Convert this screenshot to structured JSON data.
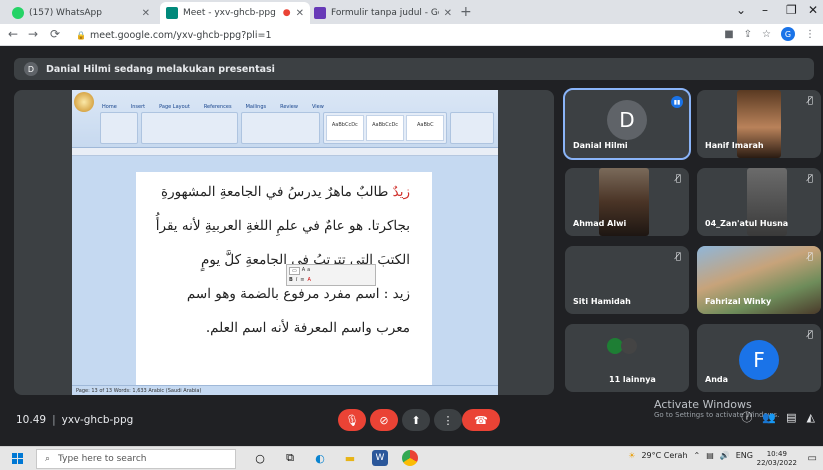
{
  "browser": {
    "tabs": [
      {
        "title": "(157) WhatsApp",
        "color": "#25d366"
      },
      {
        "title": "Meet - yxv-ghcb-ppg",
        "color": "#00897b"
      },
      {
        "title": "Formulir tanpa judul - Google Fo",
        "color": "#673ab7"
      }
    ],
    "url": "meet.google.com/yxv-ghcb-ppg?pli=1",
    "profile_initial": "G"
  },
  "presenter_bar": {
    "initial": "D",
    "text": "Danial Hilmi sedang melakukan presentasi"
  },
  "word_document": {
    "ribbon_tabs": [
      "Home",
      "Insert",
      "Page Layout",
      "References",
      "Mailings",
      "Review",
      "View"
    ],
    "style_boxes": [
      "AaBbCcDc",
      "AaBbCcDc",
      "AaBbC"
    ],
    "lines": [
      {
        "red": "زيدٌ",
        "text": " طالبٌ ماهرٌ يدرسُ في الجامعةِ المشهورةِ"
      },
      {
        "red": "",
        "text": "بجاكرتا. هو عامٌ في علمِ اللغةِ العربيةِ لأنه يقرأُ"
      },
      {
        "red": "",
        "text": "الكتبَ التي تترتبُ في الجامعةِ كلَّ يومٍ"
      },
      {
        "red": "",
        "text": "زيد : اسم مفرد مرفوع بالضمة وهو اسم"
      },
      {
        "red": "",
        "text": "معرب واسم المعرفة لأنه اسم العلم."
      }
    ],
    "status": "Page: 13 of 13   Words: 1,633   Arabic (Saudi Arabia)"
  },
  "participants": [
    {
      "name": "Danial Hilmi",
      "initial": "D",
      "type": "avatar",
      "color": "#5f6368",
      "speaking": true
    },
    {
      "name": "Hanif Imarah",
      "type": "video",
      "muted": true
    },
    {
      "name": "Ahmad Alwi",
      "type": "video",
      "muted": true
    },
    {
      "name": "04_Zan'atul Husna",
      "type": "video",
      "muted": true
    },
    {
      "name": "Siti Hamidah",
      "type": "video",
      "muted": true
    },
    {
      "name": "Fahrizal Winky",
      "type": "video",
      "muted": true
    },
    {
      "name": "11 lainnya",
      "type": "group"
    },
    {
      "name": "Anda",
      "initial": "F",
      "type": "avatar",
      "color": "#1a73e8",
      "muted": true
    }
  ],
  "meeting": {
    "time": "10.49",
    "separator": "|",
    "code": "yxv-ghcb-ppg"
  },
  "controls": {
    "mic": "mic-off",
    "camera": "camera-off",
    "present": "present",
    "more": "more",
    "end": "end-call"
  },
  "watermark": {
    "title": "Activate Windows",
    "subtitle": "Go to Settings to activate Windows."
  },
  "taskbar": {
    "search_placeholder": "Type here to search",
    "weather": "29°C Cerah",
    "language": "ENG",
    "time": "10:49",
    "date": "22/03/2022"
  }
}
